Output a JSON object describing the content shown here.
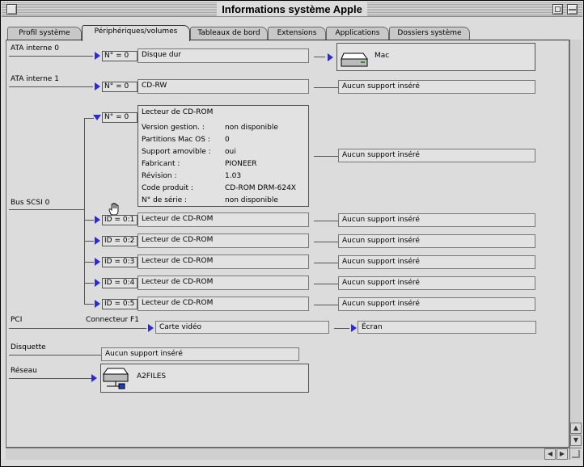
{
  "window": {
    "title": "Informations système Apple"
  },
  "tabs": [
    {
      "label": "Profil système"
    },
    {
      "label": "Périphériques/volumes"
    },
    {
      "label": "Tableaux de bord"
    },
    {
      "label": "Extensions"
    },
    {
      "label": "Applications"
    },
    {
      "label": "Dossiers système"
    }
  ],
  "buses": {
    "ata0": "ATA interne 0",
    "ata1": "ATA interne 1",
    "scsi0": "Bus SCSI 0",
    "pci": "PCI",
    "pci_slot": "Connecteur F1",
    "floppy": "Disquette",
    "network": "Réseau"
  },
  "ata0": {
    "id": "N° = 0",
    "device": "Disque dur",
    "volume": "Mac"
  },
  "ata1": {
    "id": "N° = 0",
    "device": "CD-RW",
    "media": "Aucun support inséré"
  },
  "scsi_detail": {
    "id": "N° = 0",
    "title": "Lecteur de CD-ROM",
    "rows": [
      {
        "k": "Version gestion. :",
        "v": "non disponible"
      },
      {
        "k": "Partitions Mac OS :",
        "v": "0"
      },
      {
        "k": "Support amovible :",
        "v": "oui"
      },
      {
        "k": "Fabricant :",
        "v": "PIONEER"
      },
      {
        "k": "Révision :",
        "v": "1.03"
      },
      {
        "k": "Code produit :",
        "v": "CD-ROM DRM-624X"
      },
      {
        "k": "N° de série :",
        "v": "non disponible"
      }
    ],
    "media": "Aucun support inséré"
  },
  "scsi_devices": [
    {
      "id": "ID = 0:1",
      "device": "Lecteur de CD-ROM",
      "media": "Aucun support inséré"
    },
    {
      "id": "ID = 0:2",
      "device": "Lecteur de CD-ROM",
      "media": "Aucun support inséré"
    },
    {
      "id": "ID = 0:3",
      "device": "Lecteur de CD-ROM",
      "media": "Aucun support inséré"
    },
    {
      "id": "ID = 0:4",
      "device": "Lecteur de CD-ROM",
      "media": "Aucun support inséré"
    },
    {
      "id": "ID = 0:5",
      "device": "Lecteur de CD-ROM",
      "media": "Aucun support inséré"
    }
  ],
  "pci": {
    "card": "Carte vidéo",
    "display": "Écran"
  },
  "floppy": {
    "media": "Aucun support inséré"
  },
  "network": {
    "volume": "A2FILES"
  }
}
